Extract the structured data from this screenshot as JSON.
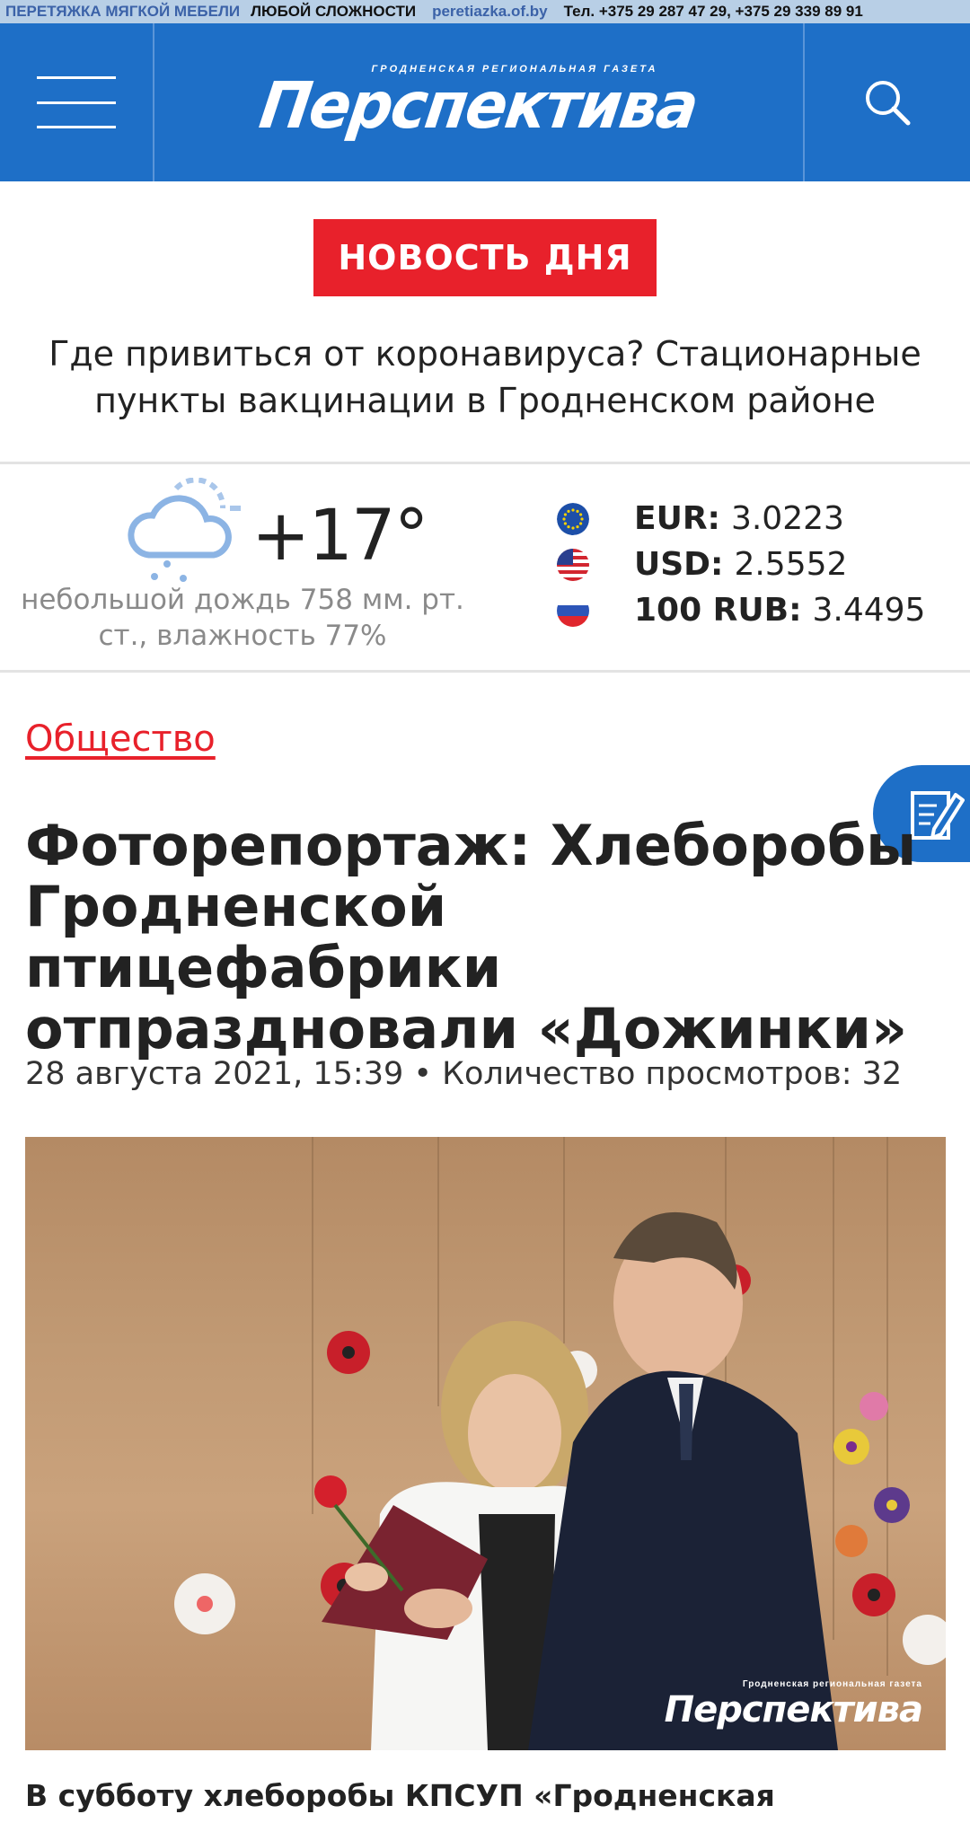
{
  "ad": {
    "part1": "ПЕРЕТЯЖКА МЯГКОЙ МЕБЕЛИ",
    "part2": "ЛЮБОЙ СЛОЖНОСТИ",
    "site": "peretiazka.of.by",
    "phones": "Тел. +375 29 287 47 29, +375 29 339 89 91"
  },
  "header": {
    "logo_subtitle": "Гродненская региональная газета",
    "logo_title": "Перспектива"
  },
  "news_of_day": {
    "badge": "НОВОСТЬ ДНЯ",
    "headline": "Где привиться от коронавируса? Стационарные пункты вакцинации в Гродненском районе"
  },
  "weather": {
    "temperature": "+17°",
    "description": "небольшой дождь 758 мм. рт. ст., влажность 77%",
    "icon": "cloud-rain-icon"
  },
  "currencies": [
    {
      "code": "EUR:",
      "rate": "3.0223",
      "flag": "eu-flag-icon"
    },
    {
      "code": "USD:",
      "rate": "2.5552",
      "flag": "us-flag-icon"
    },
    {
      "code": "100 RUB:",
      "rate": "3.4495",
      "flag": "ru-flag-icon"
    }
  ],
  "article": {
    "category": "Общество",
    "title": "Фоторепортаж: Хлеборобы Гродненской птицефабрики отпраздновали «Дожинки»",
    "meta": "28 августа 2021, 15:39 • Количество просмотров: 32",
    "photo_watermark_sub": "Гродненская региональная газета",
    "photo_watermark": "Перспектива",
    "lead": "В субботу хлеборобы КПСУП «Гродненская"
  },
  "colors": {
    "brand_blue": "#1e6fc7",
    "accent_red": "#e8212b"
  }
}
